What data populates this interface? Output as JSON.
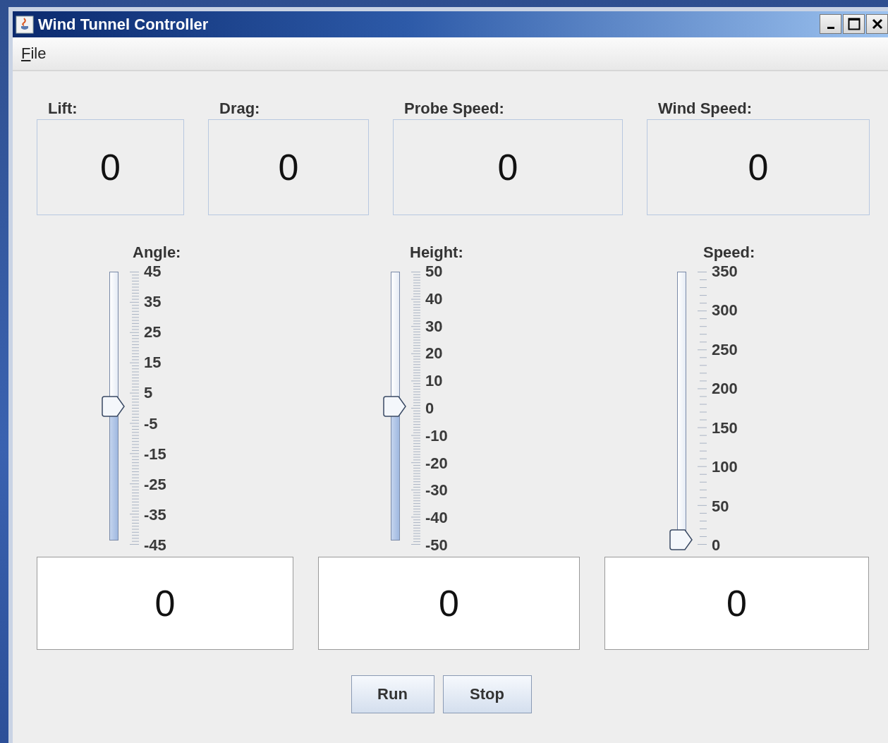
{
  "window": {
    "title": "Wind Tunnel Controller"
  },
  "menu": [
    {
      "label": "File"
    }
  ],
  "readouts": [
    {
      "label": "Lift:",
      "value": "0"
    },
    {
      "label": "Drag:",
      "value": "0"
    },
    {
      "label": "Probe Speed:",
      "value": "0"
    },
    {
      "label": "Wind Speed:",
      "value": "0"
    }
  ],
  "sliders": [
    {
      "label": "Angle:",
      "fine_ticks": true,
      "level": 0.5,
      "ticks": [
        "45",
        "35",
        "25",
        "15",
        "5",
        "-5",
        "-15",
        "-25",
        "-35",
        "-45"
      ],
      "value": "0"
    },
    {
      "label": "Height:",
      "fine_ticks": true,
      "level": 0.5,
      "ticks": [
        "50",
        "40",
        "30",
        "20",
        "10",
        "0",
        "-10",
        "-20",
        "-30",
        "-40",
        "-50"
      ],
      "value": "0"
    },
    {
      "label": "Speed:",
      "fine_ticks": false,
      "level": 0,
      "ticks": [
        "350",
        "300",
        "250",
        "200",
        "150",
        "100",
        "50",
        "0"
      ],
      "value": "0"
    }
  ],
  "buttons": [
    "Run",
    "Stop"
  ]
}
